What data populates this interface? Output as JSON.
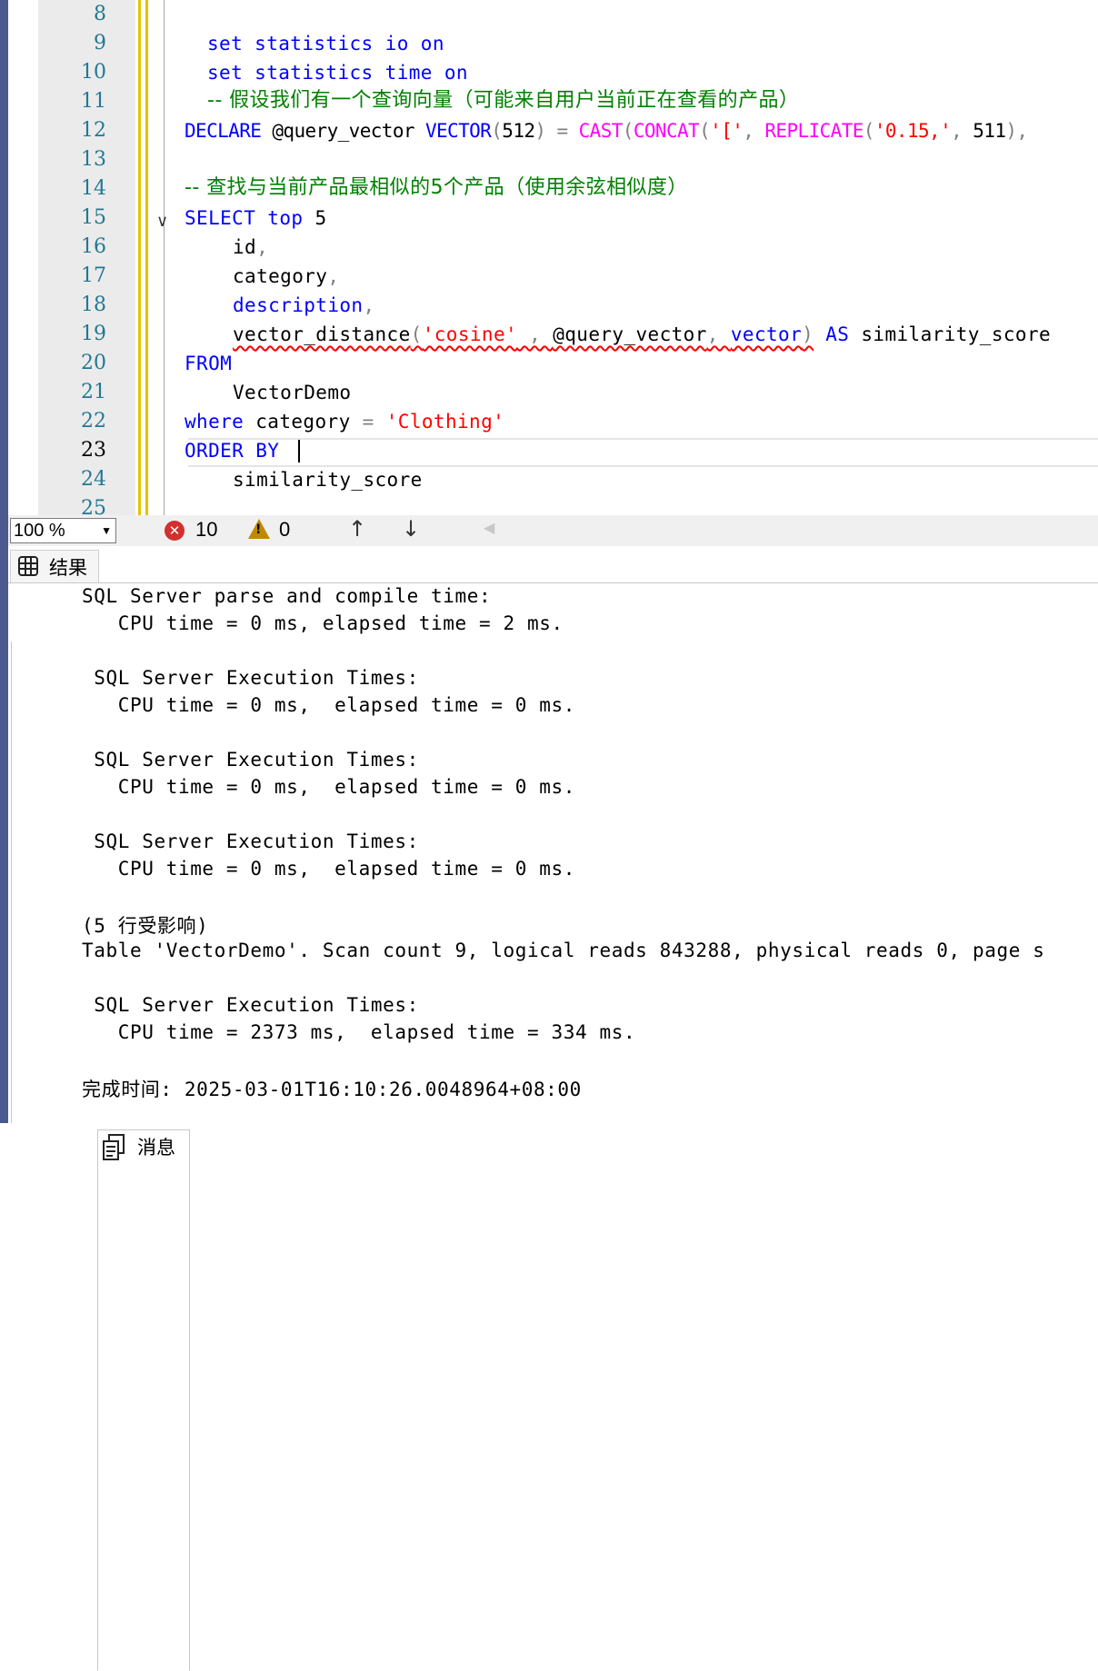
{
  "editor": {
    "line_numbers": [
      "8",
      "9",
      "10",
      "11",
      "12",
      "13",
      "14",
      "15",
      "16",
      "17",
      "18",
      "19",
      "20",
      "21",
      "22",
      "23",
      "24",
      "25"
    ],
    "current_line": "23",
    "line9": {
      "kw": "set statistics io on"
    },
    "line10": {
      "kw": "set statistics time on"
    },
    "line11": {
      "comment": "-- 假设我们有一个查询向量（可能来自用户当前正在查看的产品）"
    },
    "line12": {
      "declare": "DECLARE",
      "var": " @query_vector ",
      "type": "VECTOR",
      "p1": "(",
      "n512": "512",
      "p2": ")",
      "eq": " = ",
      "cast": "CAST",
      "p3": "(",
      "concat": "CONCAT",
      "p4": "(",
      "s1": "'['",
      "comma1": ", ",
      "replicate": "REPLICATE",
      "p5": "(",
      "s2": "'0.15,'",
      "comma2": ", ",
      "n511": "511",
      "p6": ")",
      "comma3": ","
    },
    "line14": {
      "comment": "-- 查找与当前产品最相似的5个产品（使用余弦相似度）"
    },
    "line15": {
      "select": "SELECT",
      "top": " top",
      "five": " 5"
    },
    "line16": {
      "col": "id",
      "comma": ","
    },
    "line17": {
      "col": "category",
      "comma": ","
    },
    "line18": {
      "col": "description",
      "comma": ","
    },
    "line19": {
      "fn": "vector_distance",
      "p1": "(",
      "s": "'cosine'",
      "c1": " , ",
      "var": "@query_vector",
      "c2": ", ",
      "col": "vector",
      "p2": ")",
      "as": " AS",
      "alias": " similarity_score"
    },
    "line20": {
      "kw": "FROM"
    },
    "line21": {
      "table": "VectorDemo"
    },
    "line22": {
      "kw": "where",
      "col": " category ",
      "eq": "=",
      "s": " 'Clothing'"
    },
    "line23": {
      "kw": "ORDER BY "
    },
    "line24": {
      "col": "similarity_score"
    }
  },
  "statusbar": {
    "zoom": "100 %",
    "errors": "10",
    "warnings": "0"
  },
  "tabs": {
    "results": "结果",
    "messages": "消息"
  },
  "messages": {
    "l1": "SQL Server parse and compile time:",
    "l2": "   CPU time = 0 ms, elapsed time = 2 ms.",
    "l3": " SQL Server Execution Times:",
    "l4": "   CPU time = 0 ms,  elapsed time = 0 ms.",
    "l5": " SQL Server Execution Times:",
    "l6": "   CPU time = 0 ms,  elapsed time = 0 ms.",
    "l7": " SQL Server Execution Times:",
    "l8": "   CPU time = 0 ms,  elapsed time = 0 ms.",
    "l9a": "(5 ",
    "l9b": "行受影响",
    "l9c": ")",
    "l10": "Table 'VectorDemo'. Scan count 9, logical reads 843288, physical reads 0, page s",
    "l11": " SQL Server Execution Times:",
    "l12": "   CPU time = 2373 ms,  elapsed time = 334 ms.",
    "l13a": "完成时间",
    "l13b": ": 2025-03-01T16:10:26.0048964+08:00"
  },
  "icons": {
    "error": "error-circle-icon",
    "warning": "warning-triangle-icon",
    "up": "arrow-up-icon",
    "down": "arrow-down-icon",
    "grid": "grid-icon",
    "messages": "messages-icon"
  },
  "colors": {
    "keyword": "#0000ff",
    "function": "#ff00ff",
    "string": "#ff0000",
    "comment": "#008000",
    "line_number": "#237893",
    "change_marker": "#e2c400"
  }
}
